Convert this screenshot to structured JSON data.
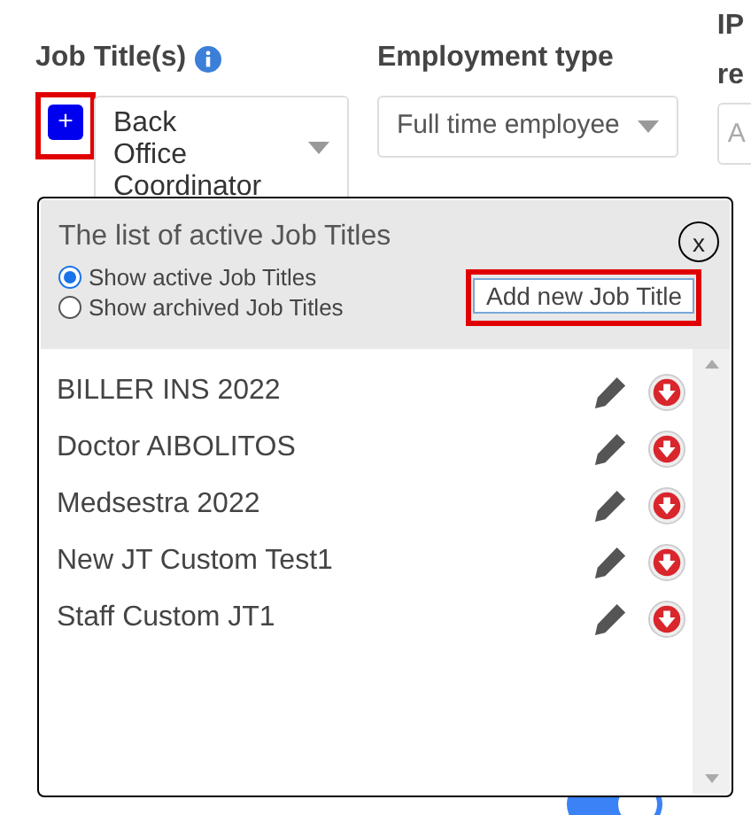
{
  "job_titles_field": {
    "label": "Job Title(s)",
    "add_button": "+",
    "value": "Back Office Coordinator"
  },
  "employment_type": {
    "label": "Employment type",
    "value": "Full time employee"
  },
  "column_3": {
    "label_lines": [
      "IP",
      "re"
    ],
    "placeholder": "A"
  },
  "patient_portal_toggle": {
    "on": true
  },
  "popup": {
    "title": "The list of active Job Titles",
    "close": "x",
    "filters": [
      {
        "label": "Show active Job Titles",
        "selected": true
      },
      {
        "label": "Show archived Job Titles",
        "selected": false
      }
    ],
    "add_button": "Add new Job Title",
    "items": [
      {
        "name": "BILLER INS 2022"
      },
      {
        "name": "Doctor AIBOLITOS"
      },
      {
        "name": "Medsestra 2022"
      },
      {
        "name": "New JT Custom Test1"
      },
      {
        "name": "Staff Custom JT1"
      }
    ]
  }
}
